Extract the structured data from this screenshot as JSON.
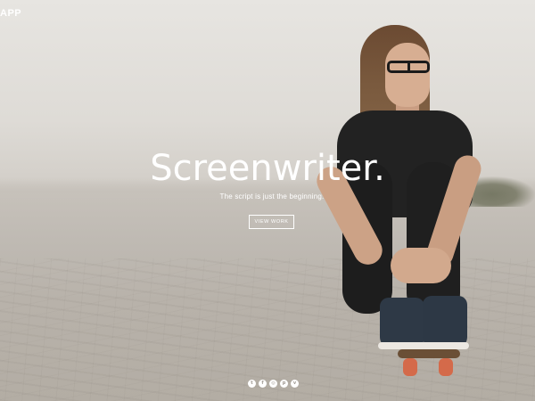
{
  "brand": {
    "logo_text": "APP"
  },
  "hero": {
    "title": "Screenwriter.",
    "subtitle": "The script is just the beginning.",
    "cta_label": "VIEW WORK"
  },
  "social": [
    {
      "icon": "twitter-icon",
      "glyph": "t"
    },
    {
      "icon": "facebook-icon",
      "glyph": "f"
    },
    {
      "icon": "instagram-icon",
      "glyph": "◎"
    },
    {
      "icon": "pinterest-icon",
      "glyph": "p"
    },
    {
      "icon": "vimeo-icon",
      "glyph": "v"
    }
  ],
  "colors": {
    "text": "#ffffff",
    "sky": "#e3e1dd",
    "ground": "#b6b0a7"
  }
}
